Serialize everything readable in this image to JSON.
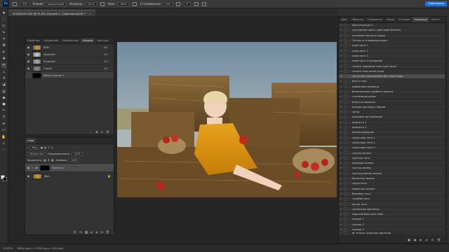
{
  "options_bar": {
    "app_logo": "Ps",
    "brush_size": "300",
    "mode_label": "Режим:",
    "mode_value": "Нормальный",
    "opacity_label": "Непрозр.:",
    "opacity_value": "100%",
    "pressure_label": "Наж.:",
    "pressure_value": "100%",
    "smoothing_label": "Сглаживание:",
    "smoothing_value": "10%",
    "angle_value": "0°",
    "share_label": "Публикация"
  },
  "document_tab": {
    "title": "0C0A0515.CR2 @ 31,8% (Группа 1, Слой-маска/16) *",
    "close": "×"
  },
  "channels_panel": {
    "tabs": [
      "Свойства",
      "Коррекция",
      "Библиотеки",
      "Каналы",
      "Контуры"
    ],
    "active_tab": "Каналы",
    "rows": [
      {
        "name": "RGB",
        "key": "⌘2"
      },
      {
        "name": "Красный",
        "key": "⌘3"
      },
      {
        "name": "Зеленый",
        "key": "⌘4"
      },
      {
        "name": "Синий",
        "key": "⌘5"
      },
      {
        "name": "Маска Группа 1",
        "key": ""
      }
    ]
  },
  "layers_panel": {
    "tabs": [
      "Слои"
    ],
    "kind_label": "Вид",
    "blend_mode": "Пропустить",
    "opacity_label": "Непрозрачность:",
    "opacity_value": "100%",
    "lock_label": "Закрепить:",
    "fill_label": "Заливка:",
    "fill_value": "100%",
    "layers": [
      {
        "name": "Группа 1",
        "type": "group"
      },
      {
        "name": "Фон",
        "type": "background"
      }
    ]
  },
  "actions_panel": {
    "tabs": [
      "Цвет",
      "Образцы",
      "Градиенты",
      "Узоры",
      "История",
      "Операции",
      "Кисти"
    ],
    "active_tab": "Операции",
    "items": [
      "ваэкспозиция 2",
      "улучшение цвета (цветовой баланс)",
      "усиление чистоты кадра",
      "Четкость и микроконтраст",
      "осветлить 1",
      "осветлить 2",
      "осветлить 3",
      "осветлить 4 холодный",
      "только придание текстуры кожи",
      "только смягчение кожи",
      "частотное разложение без пластиков",
      "блеск глаз",
      "добавляем румянца",
      "белоснежная улыбка и зрачки",
      "стилизация волос",
      "блеск на волосах",
      "красим ресницы и брови",
      "загар",
      "красивая детализация",
      "резкость 1",
      "резкость 2",
      "виньетирование",
      "сказочное лето 1",
      "сказочное лето 2",
      "сказочное лето 3",
      "сочная зелень",
      "цветное лето",
      "молодая зелень",
      "чистая зелень",
      "приглушенная зелень",
      "болотная зелень",
      "серое лето",
      "морозная зелень",
      "бежевое лето",
      "голубое лето",
      "ретро лето",
      "солнечная картинка",
      "морской бриз или небо",
      "солнце 1",
      "солнце 2",
      "солнце 3",
      "сохранение heif"
    ],
    "highlighted_item": "частотное разложение без пластиков",
    "folder_label": "панель экшенов цветения",
    "footer_icons": [
      "stop-icon",
      "record-icon",
      "play-icon",
      "folder-icon",
      "new-action-icon",
      "trash-icon"
    ]
  },
  "status_bar": {
    "zoom": "31,83%",
    "doc_info": "5640 пикс. x 3360 пикс. (300 ppi)"
  }
}
